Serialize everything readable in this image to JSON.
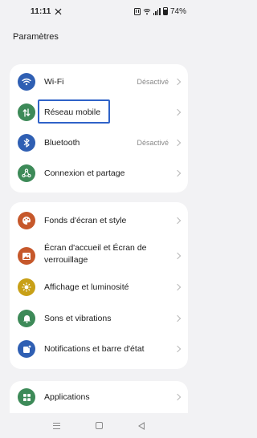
{
  "status_bar": {
    "time": "11:11",
    "battery": "74%"
  },
  "page": {
    "title": "Paramètres"
  },
  "groups": [
    {
      "items": [
        {
          "label": "Wi-Fi",
          "value": "Désactivé",
          "icon": "wifi-icon",
          "color": "#2f5fb3"
        },
        {
          "label": "Réseau mobile",
          "icon": "mobile-data-icon",
          "color": "#3d8a58"
        },
        {
          "label": "Bluetooth",
          "value": "Désactivé",
          "icon": "bluetooth-icon",
          "color": "#2f5fb3"
        },
        {
          "label": "Connexion et partage",
          "icon": "share-icon",
          "color": "#3d8a58"
        }
      ]
    },
    {
      "items": [
        {
          "label": "Fonds d'écran et style",
          "icon": "palette-icon",
          "color": "#c6582b"
        },
        {
          "label_line1": "Écran d'accueil et Écran de",
          "label_line2": "verrouillage",
          "icon": "image-icon",
          "color": "#c6582b"
        },
        {
          "label": "Affichage et luminosité",
          "icon": "brightness-icon",
          "color": "#c8a017"
        },
        {
          "label": "Sons et vibrations",
          "icon": "bell-icon",
          "color": "#3d8a58"
        },
        {
          "label": "Notifications et barre d'état",
          "icon": "notification-icon",
          "color": "#2f5fb3"
        }
      ]
    },
    {
      "items": [
        {
          "label": "Applications",
          "icon": "apps-icon",
          "color": "#3d8a58"
        }
      ]
    }
  ]
}
